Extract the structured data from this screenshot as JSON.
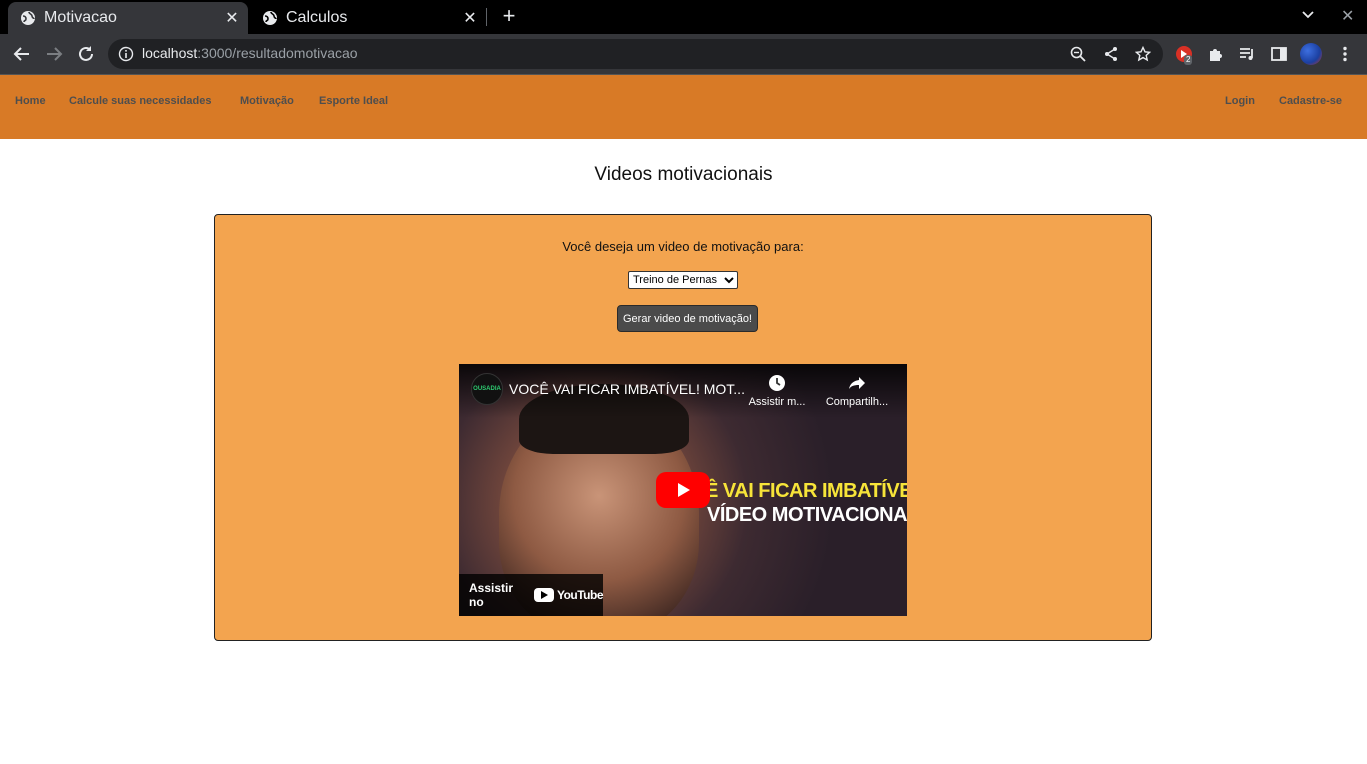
{
  "browser": {
    "tabs": [
      {
        "title": "Motivacao",
        "active": true
      },
      {
        "title": "Calculos",
        "active": false
      }
    ],
    "url_host": "localhost",
    "url_rest": ":3000/resultadomotivacao",
    "extension_badge": "2"
  },
  "navbar": {
    "left_links": [
      "Home",
      "Calcule suas necessidades",
      "Motivação",
      "Esporte Ideal"
    ],
    "right_links": [
      "Login",
      "Cadastre-se"
    ],
    "color": "#d87a26"
  },
  "page": {
    "title": "Videos motivacionais"
  },
  "panel": {
    "question": "Você deseja um video de motivação para:",
    "select_value": "Treino de Pernas",
    "button_label": "Gerar video de motivação!",
    "color": "#f3a44f"
  },
  "video": {
    "title": "VOCÊ VAI FICAR IMBATÍVEL! MOT...",
    "watch_later": "Assistir m...",
    "share": "Compartilh...",
    "overlay_line1": "Ê VAI FICAR IMBATÍVEL!",
    "overlay_line2": "VÍDEO MOTIVACIONAL",
    "watch_on": "Assistir no",
    "youtube_label": "YouTube",
    "channel_logo_text": "OUSADIA"
  }
}
